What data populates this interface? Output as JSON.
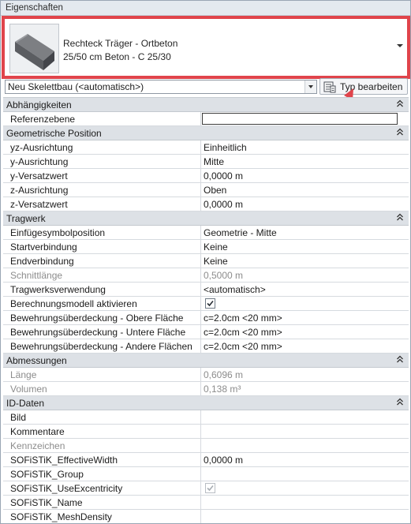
{
  "window": {
    "title": "Eigenschaften"
  },
  "type_selector": {
    "family": "Rechteck Träger - Ortbeton",
    "type": "25/50 cm Beton - C 25/30"
  },
  "instance_filter": {
    "value": "Neu Skelettbau (<automatisch>)"
  },
  "edit_type_button": {
    "label": "Typ bearbeiten"
  },
  "colors": {
    "highlight": "#e0444b",
    "annotation_arrow": "#e0444b",
    "group_header_bg": "#dde1e6"
  },
  "groups": [
    {
      "title": "Abhängigkeiten",
      "rows": [
        {
          "name": "Referenzebene",
          "value": ""
        }
      ]
    },
    {
      "title": "Geometrische Position",
      "rows": [
        {
          "name": "yz-Ausrichtung",
          "value": "Einheitlich"
        },
        {
          "name": "y-Ausrichtung",
          "value": "Mitte"
        },
        {
          "name": "y-Versatzwert",
          "value": "0,0000 m"
        },
        {
          "name": "z-Ausrichtung",
          "value": "Oben"
        },
        {
          "name": "z-Versatzwert",
          "value": "0,0000 m"
        }
      ]
    },
    {
      "title": "Tragwerk",
      "rows": [
        {
          "name": "Einfügesymbolposition",
          "value": "Geometrie - Mitte"
        },
        {
          "name": "Startverbindung",
          "value": "Keine"
        },
        {
          "name": "Endverbindung",
          "value": "Keine"
        },
        {
          "name": "Schnittlänge",
          "value": "0,5000 m"
        },
        {
          "name": "Tragwerksverwendung",
          "value": "<automatisch>"
        },
        {
          "name": "Berechnungsmodell aktivieren",
          "value": "checked"
        },
        {
          "name": "Bewehrungsüberdeckung - Obere Fläche",
          "value": "c=2.0cm <20 mm>"
        },
        {
          "name": "Bewehrungsüberdeckung - Untere Fläche",
          "value": "c=2.0cm <20 mm>"
        },
        {
          "name": "Bewehrungsüberdeckung - Andere Flächen",
          "value": "c=2.0cm <20 mm>"
        }
      ]
    },
    {
      "title": "Abmessungen",
      "rows": [
        {
          "name": "Länge",
          "value": "0,6096 m"
        },
        {
          "name": "Volumen",
          "value": "0,138 m³"
        }
      ]
    },
    {
      "title": "ID-Daten",
      "rows": [
        {
          "name": "Bild",
          "value": ""
        },
        {
          "name": "Kommentare",
          "value": ""
        },
        {
          "name": "Kennzeichen",
          "value": ""
        },
        {
          "name": "SOFiSTiK_EffectiveWidth",
          "value": "0,0000 m"
        },
        {
          "name": "SOFiSTiK_Group",
          "value": ""
        },
        {
          "name": "SOFiSTiK_UseExcentricity",
          "value": "checked"
        },
        {
          "name": "SOFiSTiK_Name",
          "value": ""
        },
        {
          "name": "SOFiSTiK_MeshDensity",
          "value": ""
        }
      ]
    }
  ]
}
